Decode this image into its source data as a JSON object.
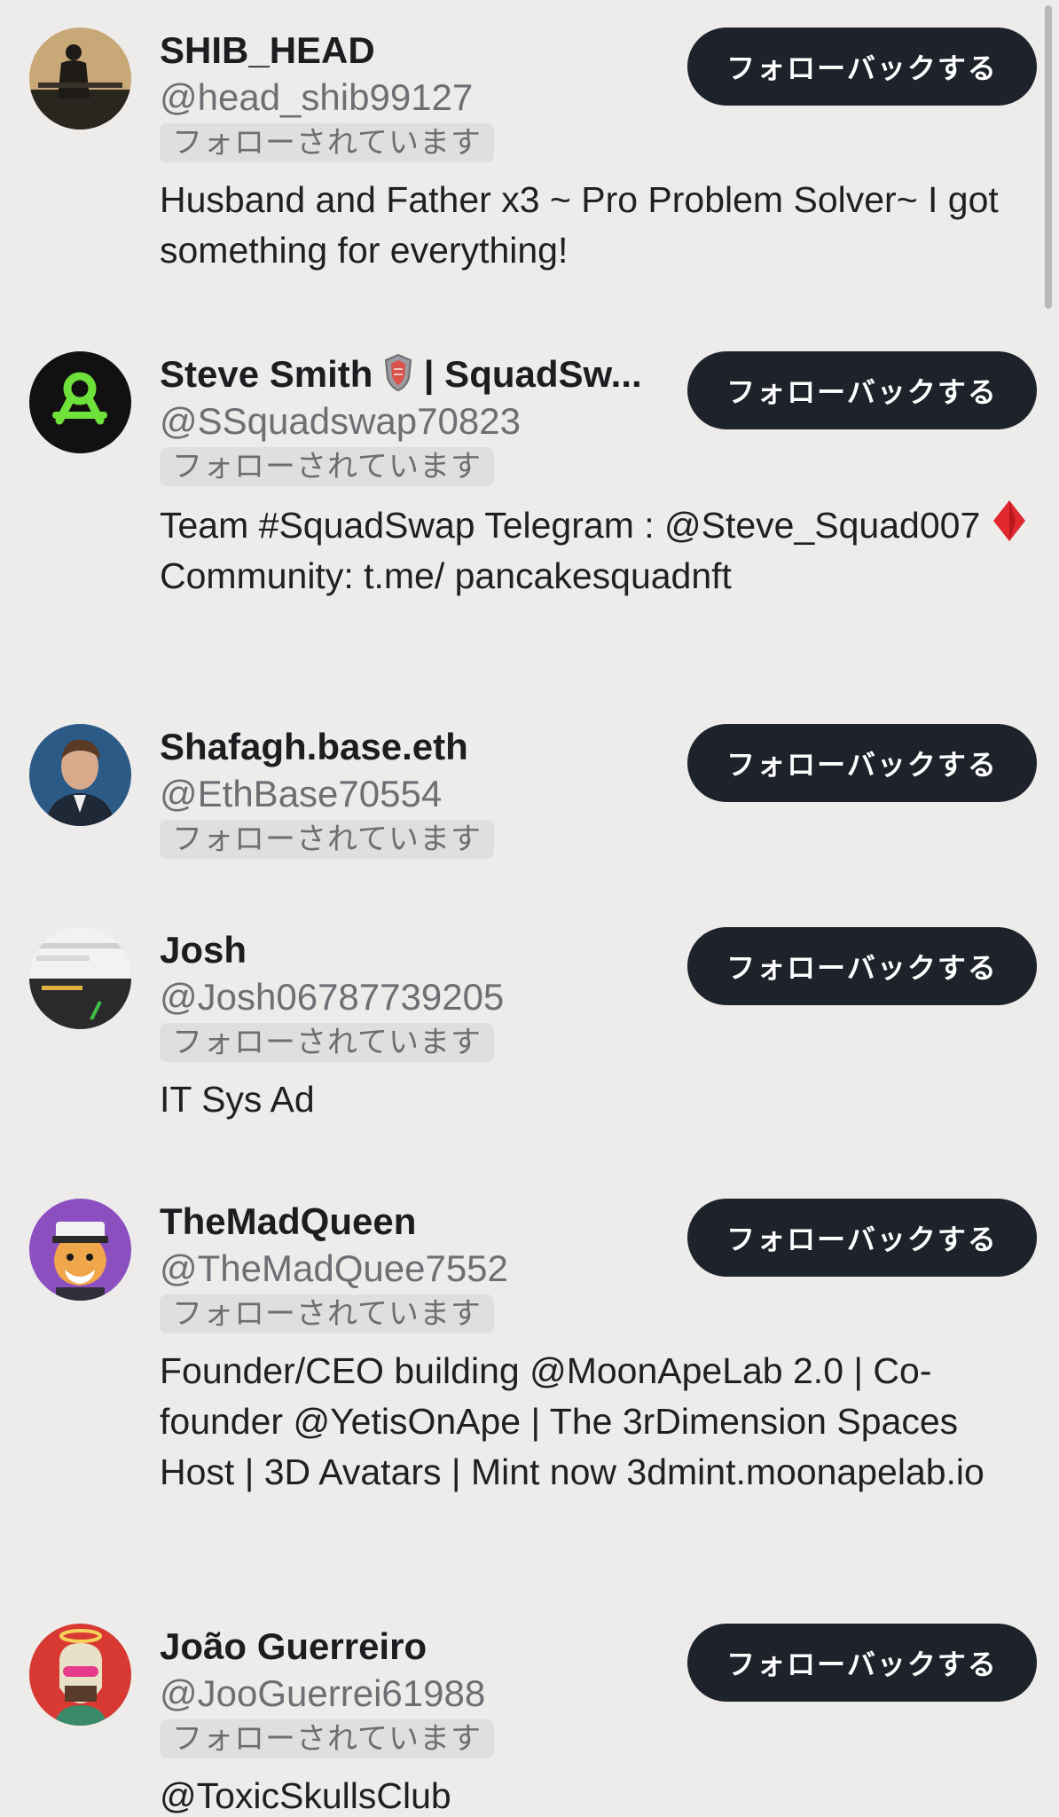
{
  "follow_back_label": "フォローバックする",
  "follows_you_label": "フォローされています",
  "users": [
    {
      "name": "SHIB_HEAD",
      "handle": "@head_shib99127",
      "bio": "Husband and Father x3 ~ Pro Problem Solver~ I got something for everything!"
    },
    {
      "name_part1": "Steve Smith",
      "name_part2": " | SquadSw...",
      "handle": "@SSquadswap70823",
      "bio_part1": "Team #SquadSwap Telegram : @Steve_Squad007 ",
      "bio_part2": " Community: t.me/ pancakesquadnft",
      "name_icon": "shield-emoji",
      "bio_icon": "red-diamond-emoji"
    },
    {
      "name": "Shafagh.base.eth",
      "handle": "@EthBase70554"
    },
    {
      "name": "Josh",
      "handle": "@Josh06787739205",
      "bio": "IT Sys Ad"
    },
    {
      "name": "TheMadQueen",
      "handle": "@TheMadQuee7552",
      "bio": "Founder/CEO building @MoonApeLab 2.0 | Co-founder @YetisOnApe | The 3rDimension Spaces Host | 3D Avatars | Mint now 3dmint.moonapelab.io"
    },
    {
      "name": "João Guerreiro",
      "handle": "@JooGuerrei61988",
      "bio": "@ToxicSkullsClub"
    }
  ],
  "colors": {
    "background": "#edeceb",
    "button": "#1e222b",
    "button_text": "#ffffff",
    "handle": "#6f6e74",
    "badge_bg": "#e0dfde"
  }
}
